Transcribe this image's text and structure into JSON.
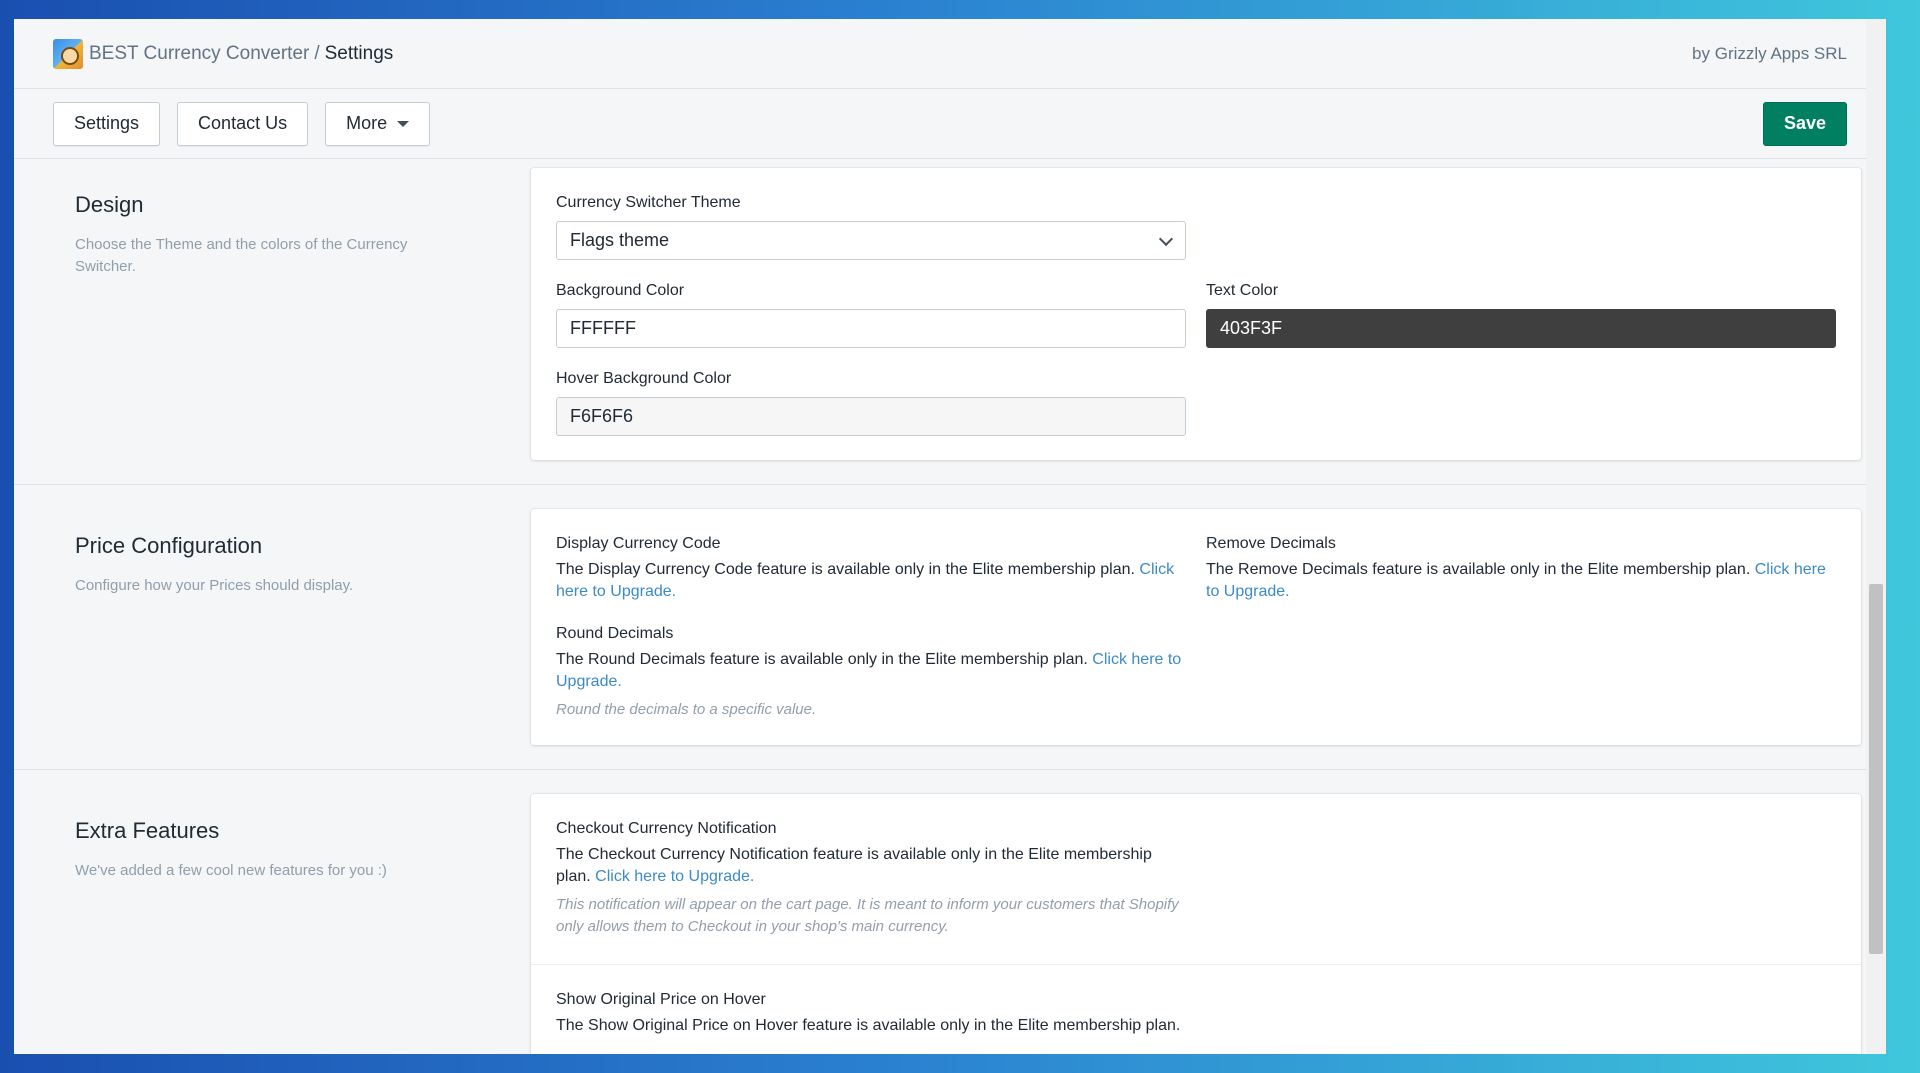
{
  "header": {
    "app_name": "BEST Currency Converter",
    "separator": "/",
    "current_page": "Settings",
    "byline": "by Grizzly Apps SRL"
  },
  "toolbar": {
    "settings_label": "Settings",
    "contact_label": "Contact Us",
    "more_label": "More",
    "save_label": "Save"
  },
  "design": {
    "title": "Design",
    "description": "Choose the Theme and the colors of the Currency Switcher.",
    "theme_label": "Currency Switcher Theme",
    "theme_value": "Flags theme",
    "bg_color_label": "Background Color",
    "bg_color_value": "FFFFFF",
    "text_color_label": "Text Color",
    "text_color_value": "403F3F",
    "hover_bg_label": "Hover Background Color",
    "hover_bg_value": "F6F6F6",
    "colors": {
      "text_color": "#403F3F",
      "hover_bg": "#F6F6F6"
    }
  },
  "price": {
    "title": "Price Configuration",
    "description": "Configure how your Prices should display.",
    "display_code_label": "Display Currency Code",
    "display_code_text": "The Display Currency Code feature is available only in the Elite membership plan.",
    "display_code_link": "Click here to Upgrade.",
    "remove_decimals_label": "Remove Decimals",
    "remove_decimals_text": "The Remove Decimals feature is available only in the Elite membership plan.",
    "remove_decimals_link": "Click here to Upgrade.",
    "round_decimals_label": "Round Decimals",
    "round_decimals_text": "The Round Decimals feature is available only in the Elite membership plan.",
    "round_decimals_link": "Click here to Upgrade.",
    "round_decimals_hint": "Round the decimals to a specific value."
  },
  "extra": {
    "title": "Extra Features",
    "description": "We've added a few cool new features for you :)",
    "checkout_label": "Checkout Currency Notification",
    "checkout_text": "The Checkout Currency Notification feature is available only in the Elite membership plan.",
    "checkout_link": "Click here to Upgrade.",
    "checkout_hint": "This notification will appear on the cart page. It is meant to inform your customers that Shopify only allows them to Checkout in your shop's main currency.",
    "hover_price_label": "Show Original Price on Hover",
    "hover_price_text": "The Show Original Price on Hover feature is available only in the Elite membership plan."
  },
  "theme": {
    "accent": "#008060",
    "link": "#3C8AC8"
  }
}
